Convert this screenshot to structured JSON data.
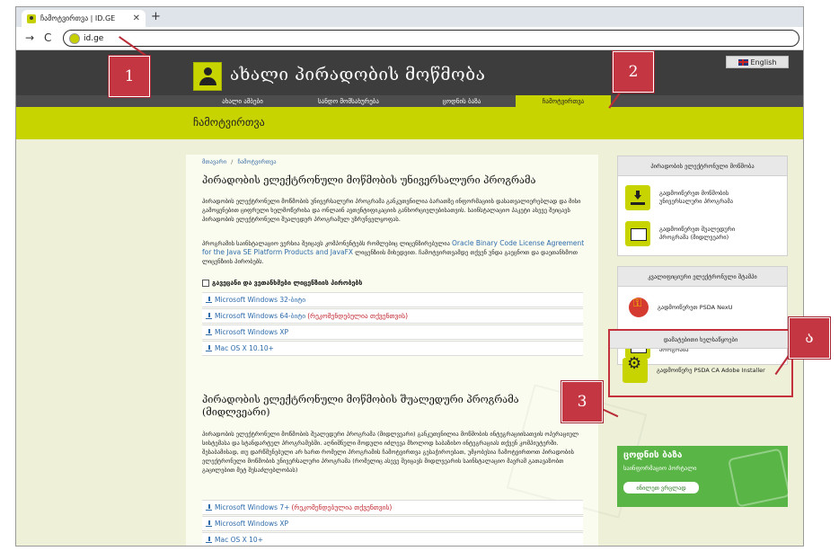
{
  "browser": {
    "tab_title": "ჩამოტვირთვა | ID.GE",
    "tab_close": "✕",
    "new_tab": "+",
    "back": "→",
    "reload": "C",
    "url": "id.ge"
  },
  "header": {
    "site_title": "ახალი პირადობის მოწმობა",
    "language_button": "English"
  },
  "nav": {
    "items": [
      "ახალი ამბები",
      "სანდო მომსახურება",
      "ცოდნის ბაზა",
      "ჩამოტვირთვა"
    ],
    "active_index": 3
  },
  "subheader": {
    "title": "ჩამოტვირთვა"
  },
  "breadcrumb": {
    "home": "მთავარი",
    "separator": "/",
    "current": "ჩამოტვირთვა"
  },
  "section1": {
    "heading": "პირადობის ელექტრონული მოწმობის უნივერსალური პროგრამა",
    "para1": "პირადობის ელექტრონული მოწმობის უნივერსალური პროგრამა განკუთვნილია ბარათზე ინფორმაციის დასათვალიერებლად და მისი გამოყენებით ციფრული ხელმოწერისა და ონლაინ ავთენტიფიკაციის განხორციელებისათვის. საინსტალაციო პაკეტი ასევე შეიცავს პირადობის ელექტრონული შუალედურ პროგრამულ უზრუნველყოფას.",
    "para2_before": "პროგრამის საინსტალაციო ვერსია შეიცავს კომპონენტებს რომლებიც ლიცენზირებულია",
    "para2_link": "Oracle Binary Code License Agreement for the Java SE Platform Products and JavaFX",
    "para2_after": "ლიცენზიის მიხედვით. ჩამოტვირთვამდე თქვენ უნდა გაეცნოთ და დაეთანხმოთ ლიცენზიის პირობებს.",
    "checkbox_label": "გავეცანი და ვეთანხმები ლიცენზიის პირობებს",
    "downloads": [
      {
        "label": "Microsoft Windows 32-ბიტი",
        "note": ""
      },
      {
        "label": "Microsoft Windows 64-ბიტი",
        "note": "(რეკომენდებულია თქვენთვის)"
      },
      {
        "label": "Microsoft Windows XP",
        "note": ""
      },
      {
        "label": "Mac OS X 10.10+",
        "note": ""
      }
    ]
  },
  "section2": {
    "heading_line1": "პირადობის ელექტრონული მოწმობის შუალედური პროგრამა",
    "heading_line2": "(მიდლვეარი)",
    "para": "პირადობის ელექტრონული მოწმობის შუალედური პროგრამა (მიდლვეარი) განკუთვნილია მოწმობის ინტეგრაციისათვის ოპერაციულ სისტემასა და სტანდარტულ პროგრამებში. აღნიშნული მოდული იძლევა მხოლოდ საბაზისო ინტეგრაციას თქვენ კომპიუტერში. შესაბამისად, თუ დარწმუნებული არ ხართ რომელი პროგრამის ჩამოტვირთვა გესაჭიროებათ, უმჯობესია ჩამოტვირთოთ პირადობის ელექტრონული მოწმობის უნივერსალური პროგრამა (რომელიც ასევე შეიცავს მიდლვეარის საინსტალაციო მაერამ გათავაზობთ გაცილებით მეტ შესაძლებლობას)",
    "downloads": [
      {
        "label": "Microsoft Windows 7+",
        "note": "(რეკომენდებულია თქვენთვის)"
      },
      {
        "label": "Microsoft Windows XP",
        "note": ""
      },
      {
        "label": "Mac OS X 10+",
        "note": ""
      }
    ]
  },
  "sidebar": {
    "panel1": {
      "title": "პირადობის ელექტრონული მოწმობა",
      "items": [
        "გადმოიწერეთ მოწმობის\nუნივერსალური პროგრამა",
        "გადმოიწერეთ შუალედური\nპროგრამა (მიდლვეარი)"
      ]
    },
    "panel2": {
      "title": "კვალიფიციური ელექტრონული შტამპი",
      "items": [
        "გადმოიწერეთ PSDA NexU",
        "შტამპის ბარათის შუალედური\nპროგრამა"
      ]
    },
    "panel3": {
      "title": "დამატებითი ხელსაწყოები",
      "items": [
        "გადმოიწერე PSDA CA Adobe Installer"
      ]
    },
    "knowledge": {
      "title": "ცოდნის ბაზა",
      "subtitle": "საინფორმაციო პორტალი",
      "button": "ინილეთ ვრცლად"
    }
  },
  "annotations": [
    "1",
    "2",
    "3",
    "ა"
  ],
  "colors": {
    "accent": "#c8d400",
    "annotation": "#c43641",
    "link": "#2d6bab",
    "recommended": "#c0252d"
  }
}
